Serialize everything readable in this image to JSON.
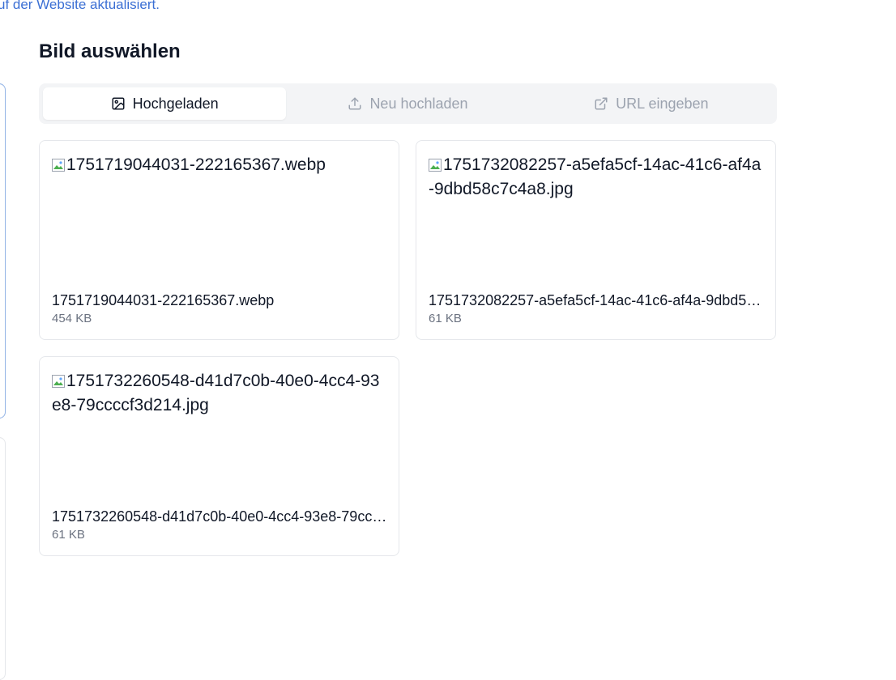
{
  "top_note": "uf der Website aktualisiert.",
  "section_title": "Bild auswählen",
  "tabs": [
    {
      "label": "Hochgeladen",
      "icon": "image-icon",
      "active": true
    },
    {
      "label": "Neu hochladen",
      "icon": "upload-icon",
      "active": false
    },
    {
      "label": "URL eingeben",
      "icon": "external-link-icon",
      "active": false
    }
  ],
  "images": [
    {
      "alt": "1751719044031-222165367.webp",
      "name": "1751719044031-222165367.webp",
      "size": "454 KB"
    },
    {
      "alt": "1751732082257-a5efa5cf-14ac-41c6-af4a-9dbd58c7c4a8.jpg",
      "name": "1751732082257-a5efa5cf-14ac-41c6-af4a-9dbd58c7c4a8.jpg",
      "size": "61 KB"
    },
    {
      "alt": "1751732260548-d41d7c0b-40e0-4cc4-93e8-79ccccf3d214.jpg",
      "name": "1751732260548-d41d7c0b-40e0-4cc4-93e8-79ccccf3d214.jpg",
      "size": "61 KB"
    }
  ],
  "colors": {
    "link": "#3b6fd4",
    "active_tab_bg": "#ffffff",
    "tabbar_bg": "#f3f4f6",
    "muted_text": "#9ca3af"
  }
}
